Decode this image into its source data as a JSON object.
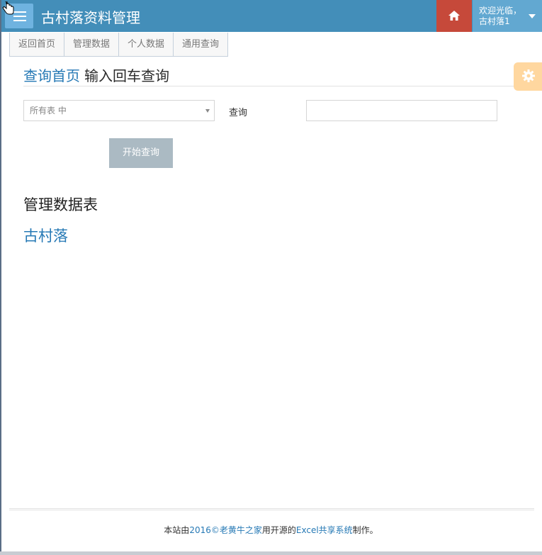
{
  "app": {
    "title": "古村落资料管理"
  },
  "header": {
    "welcome_line1": "欢迎光临，",
    "welcome_line2": "古村落1",
    "menu_icon": "menu-icon",
    "home_icon": "home-icon",
    "user_caret_icon": "caret-down-icon"
  },
  "tabs": [
    {
      "label": "返回首页"
    },
    {
      "label": "管理数据"
    },
    {
      "label": "个人数据"
    },
    {
      "label": "通用查询"
    }
  ],
  "breadcrumb": {
    "link": "查询首页",
    "text": "输入回车查询"
  },
  "form": {
    "table_select_value": "所有表 中",
    "query_label": "查询",
    "query_input_value": "",
    "start_button": "开始查询"
  },
  "section": {
    "title": "管理数据表",
    "items": [
      {
        "label": "古村落"
      }
    ]
  },
  "footer": {
    "prefix": "本站由",
    "link1": "2016©老黄牛之家",
    "middle": "用开源的",
    "link2": "Excel共享系统",
    "suffix": "制作。"
  },
  "colors": {
    "navbar": "#438eb9",
    "home_button": "#c6493a",
    "user_box": "#62a8d1",
    "link": "#2679b5",
    "settings_button": "#ffb752",
    "start_button": "#abbac3"
  }
}
